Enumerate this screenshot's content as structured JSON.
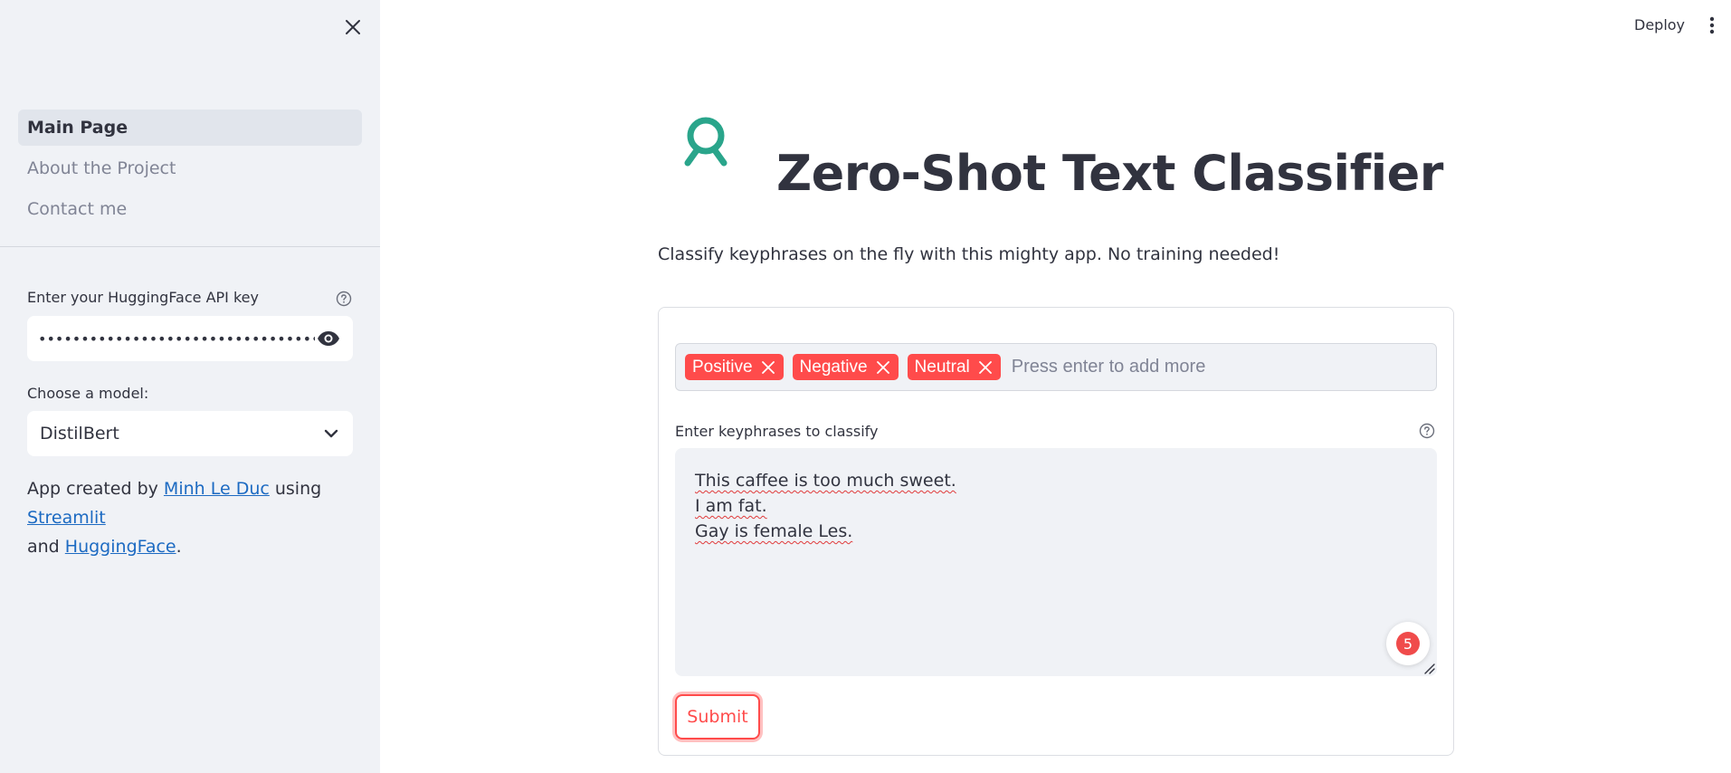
{
  "header": {
    "deploy_label": "Deploy",
    "menu_icon": "kebab-menu-icon"
  },
  "sidebar": {
    "close_icon": "close-icon",
    "nav": [
      {
        "label": "Main Page",
        "active": true
      },
      {
        "label": "About the Project",
        "active": false
      },
      {
        "label": "Contact me",
        "active": false
      }
    ],
    "api_key": {
      "label": "Enter your HuggingFace API key",
      "value": "••••••••••••••••••••••••••••••••••••••",
      "help_icon": "help-circle-icon",
      "toggle_icon": "eye-icon"
    },
    "model": {
      "label": "Choose a model:",
      "selected": "DistilBert",
      "icon": "chevron-down-icon"
    },
    "credit": {
      "prefix": "App created by ",
      "author": "Minh Le Duc",
      "using": " using ",
      "streamlit": "Streamlit",
      "and": "and ",
      "huggingface": "HuggingFace",
      "suffix": "."
    }
  },
  "main": {
    "logo_icon": "app-logo-icon",
    "title": "Zero-Shot Text Classifier",
    "subtitle": "Classify keyphrases on the fly with this mighty app. No training needed!",
    "form": {
      "tags": [
        "Positive",
        "Negative",
        "Neutral"
      ],
      "tags_placeholder": "Press enter to add more",
      "textarea_label": "Enter keyphrases to classify",
      "textarea_lines": [
        "This caffee is too much sweet.",
        "I am fat.",
        "Gay is female Les."
      ],
      "badge_count": "5",
      "submit_label": "Submit"
    }
  },
  "colors": {
    "accent": "#ff4b4b",
    "sidebar_bg": "#f0f2f6",
    "link": "#1c6ac2",
    "logo": "#2aa58b"
  }
}
